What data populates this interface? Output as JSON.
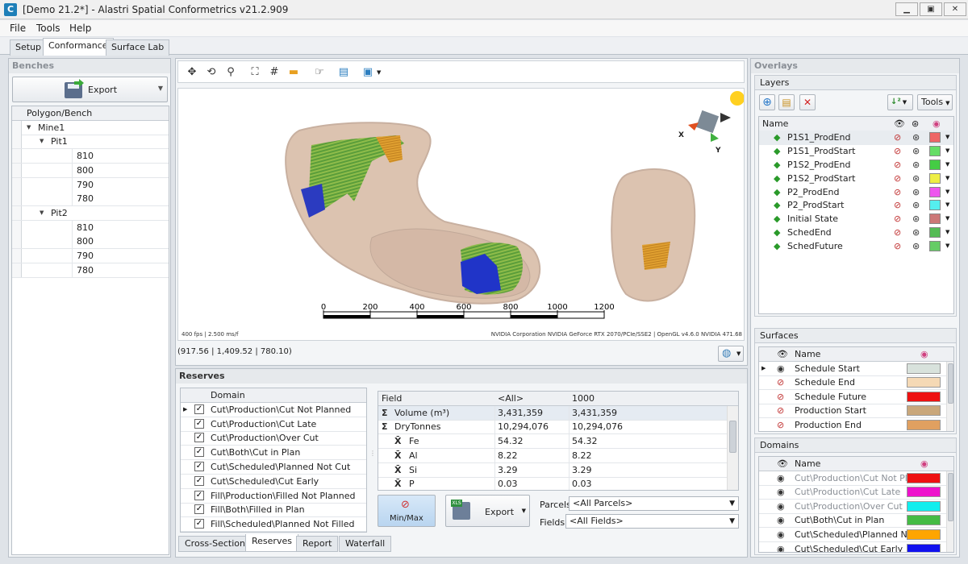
{
  "window": {
    "title": "[Demo 21.2*] - Alastri Spatial Conformetrics v21.2.909",
    "icon_letter": "C"
  },
  "menu": [
    "File",
    "Tools",
    "Help"
  ],
  "tabs": [
    "Setup",
    "Conformance",
    "Surface Lab"
  ],
  "benches": {
    "title": "Benches",
    "export_label": "Export",
    "column": "Polygon/Bench",
    "tree": [
      {
        "label": "Mine1",
        "level": 0
      },
      {
        "label": "Pit1",
        "level": 1
      },
      {
        "label": "810",
        "level": 2
      },
      {
        "label": "800",
        "level": 2
      },
      {
        "label": "790",
        "level": 2
      },
      {
        "label": "780",
        "level": 2
      },
      {
        "label": "Pit2",
        "level": 1
      },
      {
        "label": "810",
        "level": 2
      },
      {
        "label": "800",
        "level": 2
      },
      {
        "label": "790",
        "level": 2
      },
      {
        "label": "780",
        "level": 2
      }
    ]
  },
  "viewport": {
    "scale_labels": [
      "0",
      "200",
      "400",
      "600",
      "800",
      "1000",
      "1200"
    ],
    "fps": "400 fps | 2.500 ms/f",
    "renderer": "NVIDIA Corporation NVIDIA GeForce RTX 2070/PCIe/SSE2 | OpenGL v4.6.0 NVIDIA 471.68",
    "axis_x": "X",
    "axis_y": "Y",
    "coords": "(917.56 | 1,409.52 | 780.10)"
  },
  "reserves": {
    "title": "Reserves",
    "domain_header": "Domain",
    "domains": [
      "Cut\\Production\\Cut Not Planned",
      "Cut\\Production\\Cut Late",
      "Cut\\Production\\Over Cut",
      "Cut\\Both\\Cut in Plan",
      "Cut\\Scheduled\\Planned Not Cut",
      "Cut\\Scheduled\\Cut Early",
      "Fill\\Production\\Filled Not Planned",
      "Fill\\Both\\Filled in Plan",
      "Fill\\Scheduled\\Planned Not Filled"
    ],
    "fields_header": [
      "Field",
      "<All>",
      "1000"
    ],
    "fields": [
      {
        "name": "Volume (m³)",
        "all": "3,431,359",
        "v1000": "3,431,359",
        "icon": "sigma-icon"
      },
      {
        "name": "DryTonnes",
        "all": "10,294,076",
        "v1000": "10,294,076",
        "icon": "sigma-icon"
      },
      {
        "name": "Fe",
        "all": "54.32",
        "v1000": "54.32",
        "icon": "xbar-icon"
      },
      {
        "name": "Al",
        "all": "8.22",
        "v1000": "8.22",
        "icon": "xbar-icon"
      },
      {
        "name": "Si",
        "all": "3.29",
        "v1000": "3.29",
        "icon": "xbar-icon"
      },
      {
        "name": "P",
        "all": "0.03",
        "v1000": "0.03",
        "icon": "xbar-icon"
      }
    ],
    "minmax_label": "Min/Max",
    "export_label": "Export",
    "parcels_label": "Parcels",
    "parcels_value": "<All Parcels>",
    "fields_label": "Fields",
    "fields_value": "<All Fields>"
  },
  "bottom_tabs": [
    "Cross-Section",
    "Reserves",
    "Report",
    "Waterfall"
  ],
  "overlays": {
    "title": "Overlays",
    "layers_title": "Layers",
    "tools_label": "Tools",
    "name_header": "Name",
    "layers": [
      {
        "name": "P1S1_ProdEnd",
        "color": "#ee6666"
      },
      {
        "name": "P1S1_ProdStart",
        "color": "#66dd66"
      },
      {
        "name": "P1S2_ProdEnd",
        "color": "#44cc44"
      },
      {
        "name": "P1S2_ProdStart",
        "color": "#eeee44"
      },
      {
        "name": "P2_ProdEnd",
        "color": "#ee55ee"
      },
      {
        "name": "P2_ProdStart",
        "color": "#55eeee"
      },
      {
        "name": "Initial State",
        "color": "#cc7777"
      },
      {
        "name": "SchedEnd",
        "color": "#55bb55"
      },
      {
        "name": "SchedFuture",
        "color": "#66cc66"
      }
    ],
    "surfaces_title": "Surfaces",
    "surfaces": [
      {
        "name": "Schedule Start",
        "color": "#d8e2dc"
      },
      {
        "name": "Schedule End",
        "color": "#f5d9b5"
      },
      {
        "name": "Schedule Future",
        "color": "#ee1111"
      },
      {
        "name": "Production Start",
        "color": "#c9a77b"
      },
      {
        "name": "Production End",
        "color": "#e0a060"
      }
    ],
    "domains_title": "Domains",
    "domains": [
      {
        "name": "Cut\\Production\\Cut Not Plan...",
        "color": "#ee1111"
      },
      {
        "name": "Cut\\Production\\Cut Late",
        "color": "#ee11cc"
      },
      {
        "name": "Cut\\Production\\Over Cut",
        "color": "#11eeee"
      },
      {
        "name": "Cut\\Both\\Cut in Plan",
        "color": "#44bb44"
      },
      {
        "name": "Cut\\Scheduled\\Planned Not ...",
        "color": "#ffa500"
      },
      {
        "name": "Cut\\Scheduled\\Cut Early",
        "color": "#1111ee"
      }
    ]
  }
}
